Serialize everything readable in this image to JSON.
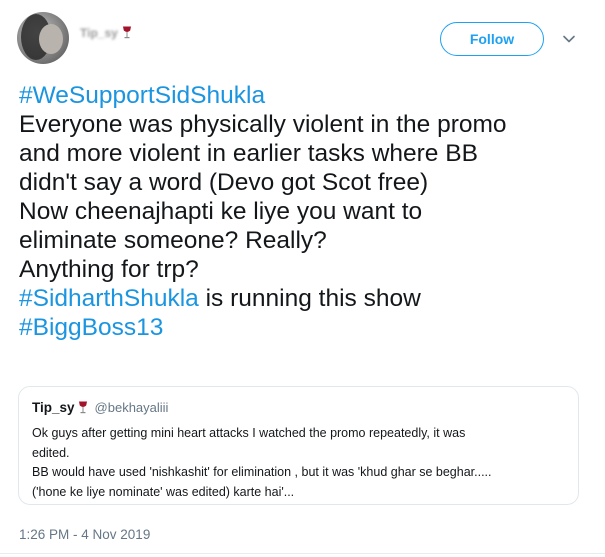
{
  "author": {
    "display_name": "Tip_sy",
    "follow_label": "Follow"
  },
  "tweet": {
    "lines": [
      {
        "text": "#WeSupportSidShukla",
        "hashtag": true
      },
      {
        "text": "Everyone was physically violent in the promo",
        "hashtag": false
      },
      {
        "text": "and more violent in earlier tasks where BB",
        "hashtag": false
      },
      {
        "text": "didn't say a word (Devo got Scot free)",
        "hashtag": false
      },
      {
        "text": "Now cheenajhapti ke liye you want to",
        "hashtag": false
      },
      {
        "text": "eliminate someone? Really?",
        "hashtag": false
      },
      {
        "text": "Anything for trp?",
        "hashtag": false
      }
    ],
    "line8_tag": "#SidharthShukla",
    "line8_rest": " is running this show",
    "line9_tag": "#BiggBoss13",
    "timestamp": "1:26 PM - 4 Nov 2019"
  },
  "quoted": {
    "name": "Tip_sy",
    "handle": "@bekhayaliii",
    "lines": [
      "Ok guys after getting mini heart attacks I watched the promo repeatedly,  it was",
      "edited.",
      "BB would have used 'nishkashit' for elimination , but it was 'khud ghar se beghar.....",
      "('hone ke liye nominate' was edited) karte hai'..."
    ]
  },
  "colors": {
    "accent": "#1da1f2",
    "hashtag": "#1b95e0",
    "secondary_text": "#657786",
    "wine": "#a3132b"
  },
  "icons": [
    "wine-glass-icon",
    "chevron-down-icon"
  ]
}
